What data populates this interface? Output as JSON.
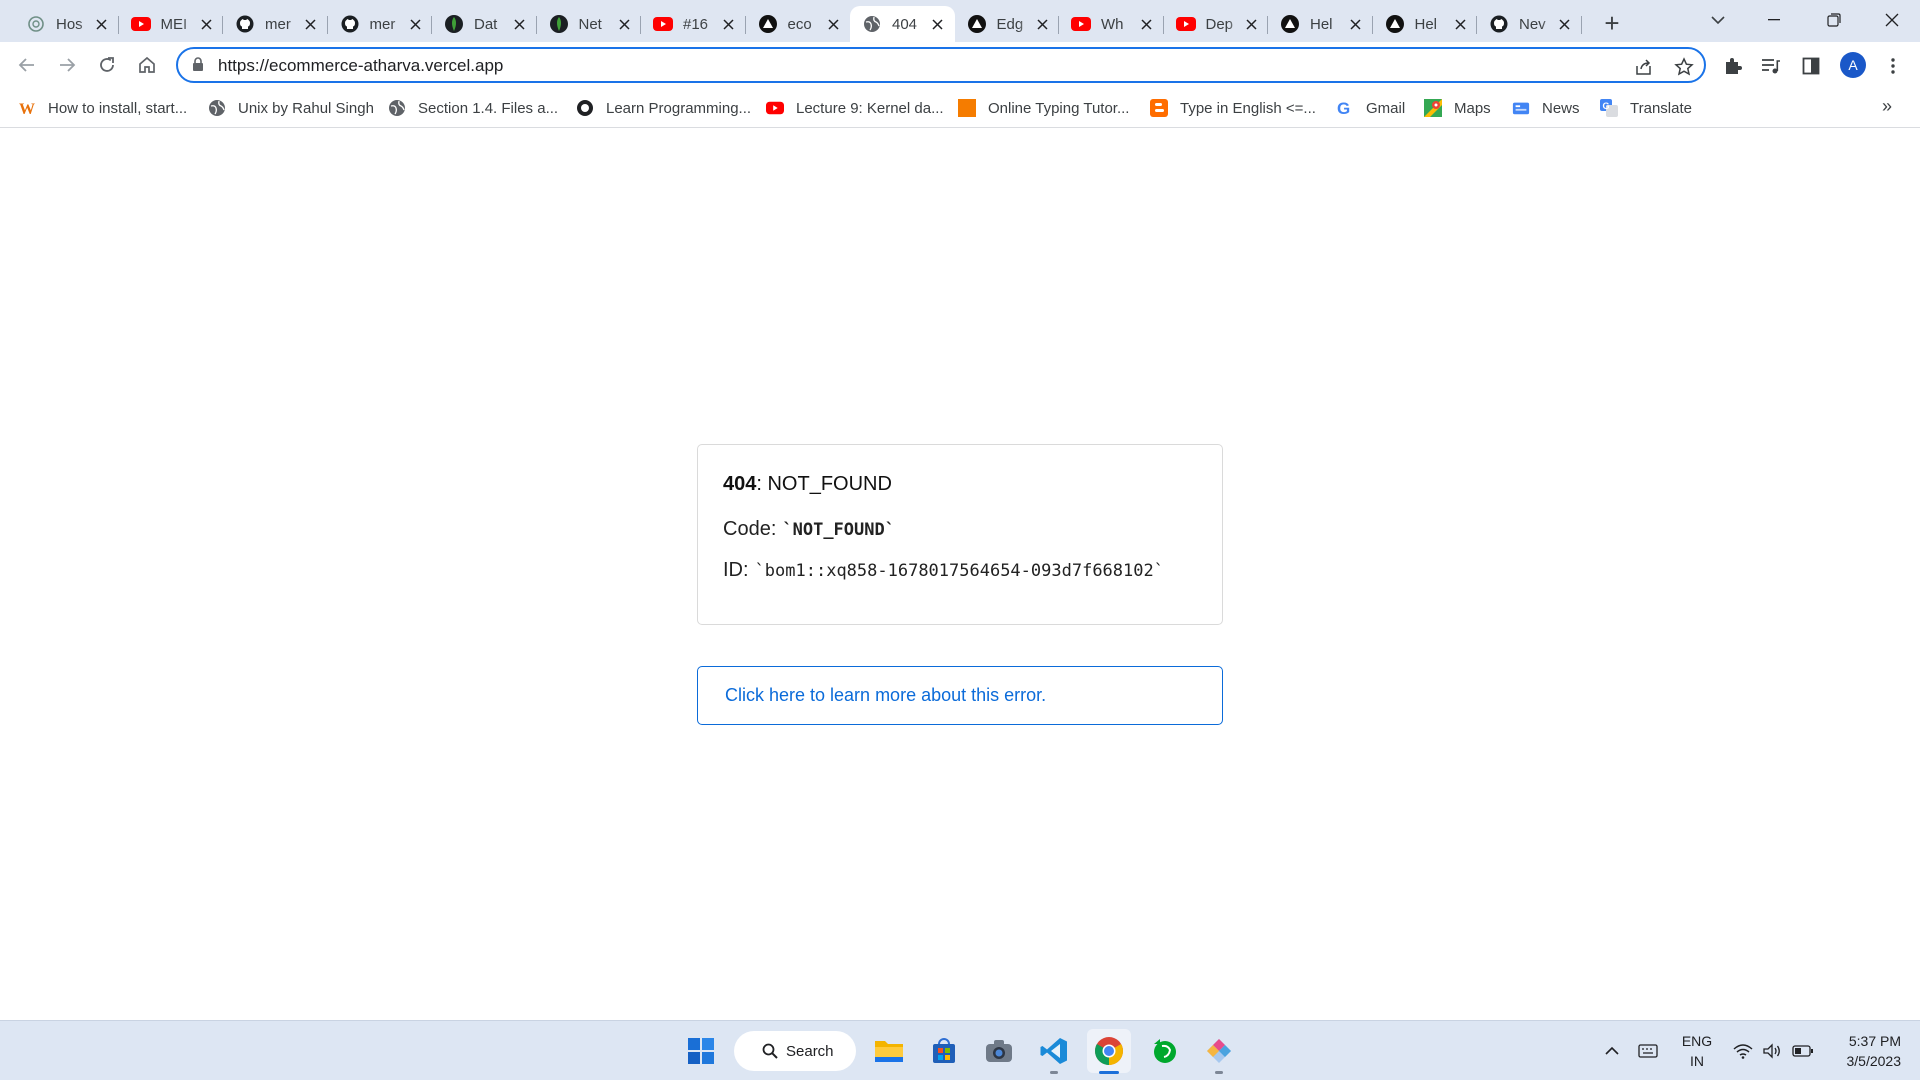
{
  "browser": {
    "tabs": [
      {
        "title": "Hos",
        "icon": "chatgpt-icon",
        "active": false
      },
      {
        "title": "MEI",
        "icon": "youtube-icon",
        "active": false
      },
      {
        "title": "mer",
        "icon": "github-icon",
        "active": false
      },
      {
        "title": "mer",
        "icon": "github-icon",
        "active": false
      },
      {
        "title": "Dat",
        "icon": "mongodb-icon",
        "active": false
      },
      {
        "title": "Net",
        "icon": "mongodb-icon",
        "active": false
      },
      {
        "title": "#16",
        "icon": "youtube-icon",
        "active": false
      },
      {
        "title": "eco",
        "icon": "vercel-icon",
        "active": false
      },
      {
        "title": "404",
        "icon": "globe-icon",
        "active": true
      },
      {
        "title": "Edg",
        "icon": "vercel-icon",
        "active": false
      },
      {
        "title": "Wh",
        "icon": "youtube-icon",
        "active": false
      },
      {
        "title": "Dep",
        "icon": "youtube-icon",
        "active": false
      },
      {
        "title": "Hel",
        "icon": "vercel-icon",
        "active": false
      },
      {
        "title": "Hel",
        "icon": "vercel-icon",
        "active": false
      },
      {
        "title": "Nev",
        "icon": "github-icon",
        "active": false
      }
    ],
    "url": "https://ecommerce-atharva.vercel.app",
    "profile_initial": "A",
    "bookmarks": [
      {
        "label": "How to install, start...",
        "icon": "w-icon"
      },
      {
        "label": "Unix by Rahul Singh",
        "icon": "globe-icon"
      },
      {
        "label": "Section 1.4.  Files a...",
        "icon": "globe-icon"
      },
      {
        "label": "Learn Programming...",
        "icon": "circle-icon"
      },
      {
        "label": "Lecture 9: Kernel da...",
        "icon": "youtube-icon"
      },
      {
        "label": "Online Typing Tutor...",
        "icon": "orange-square-icon"
      },
      {
        "label": "Type in English <=...",
        "icon": "blogger-icon"
      },
      {
        "label": "Gmail",
        "icon": "google-icon"
      },
      {
        "label": "Maps",
        "icon": "maps-icon"
      },
      {
        "label": "News",
        "icon": "news-icon"
      },
      {
        "label": "Translate",
        "icon": "translate-icon"
      }
    ]
  },
  "page": {
    "status_code": "404",
    "status_text": ": NOT_FOUND",
    "code_label": "Code:",
    "code_value": "`NOT_FOUND`",
    "id_label": "ID:",
    "id_value": "`bom1::xq858-1678017564654-093d7f668102`",
    "learn_more": "Click here to learn more about this error."
  },
  "taskbar": {
    "search_label": "Search",
    "language_line1": "ENG",
    "language_line2": "IN",
    "time": "5:37 PM",
    "date": "3/5/2023"
  },
  "colors": {
    "accent": "#1a73e8",
    "link": "#0b6bd9",
    "tabstrip": "#dfe6f2",
    "taskbar": "#dde6f3"
  }
}
